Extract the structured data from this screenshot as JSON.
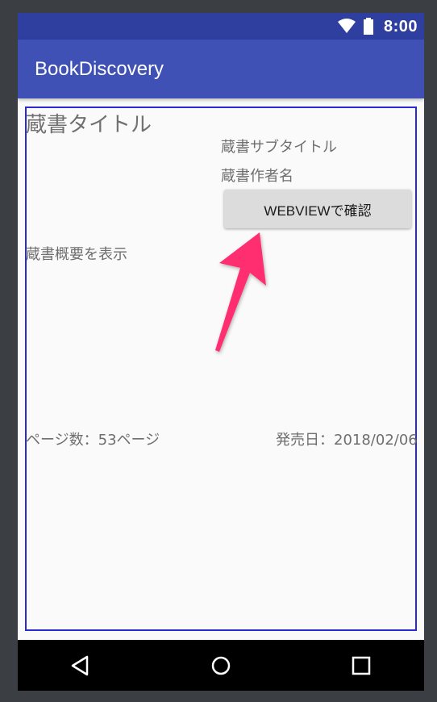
{
  "status_bar": {
    "time": "8:00",
    "icons": [
      "wifi-icon",
      "battery-icon"
    ],
    "background": "#2f3fa0"
  },
  "app_bar": {
    "title": "BookDiscovery",
    "background": "#3f51b5"
  },
  "book": {
    "title": "蔵書タイトル",
    "subtitle": "蔵書サブタイトル",
    "author": "蔵書作者名",
    "webview_button_label": "WEBVIEWで確認",
    "summary": "蔵書概要を表示",
    "pages": "ページ数：53ページ",
    "release_date": "発売日：2018/02/06"
  },
  "annotation": {
    "arrow_color": "#ff2d6f",
    "border_color": "#2a2ad0"
  },
  "nav_bar": {
    "buttons": [
      "back-icon",
      "home-icon",
      "recents-icon"
    ]
  }
}
